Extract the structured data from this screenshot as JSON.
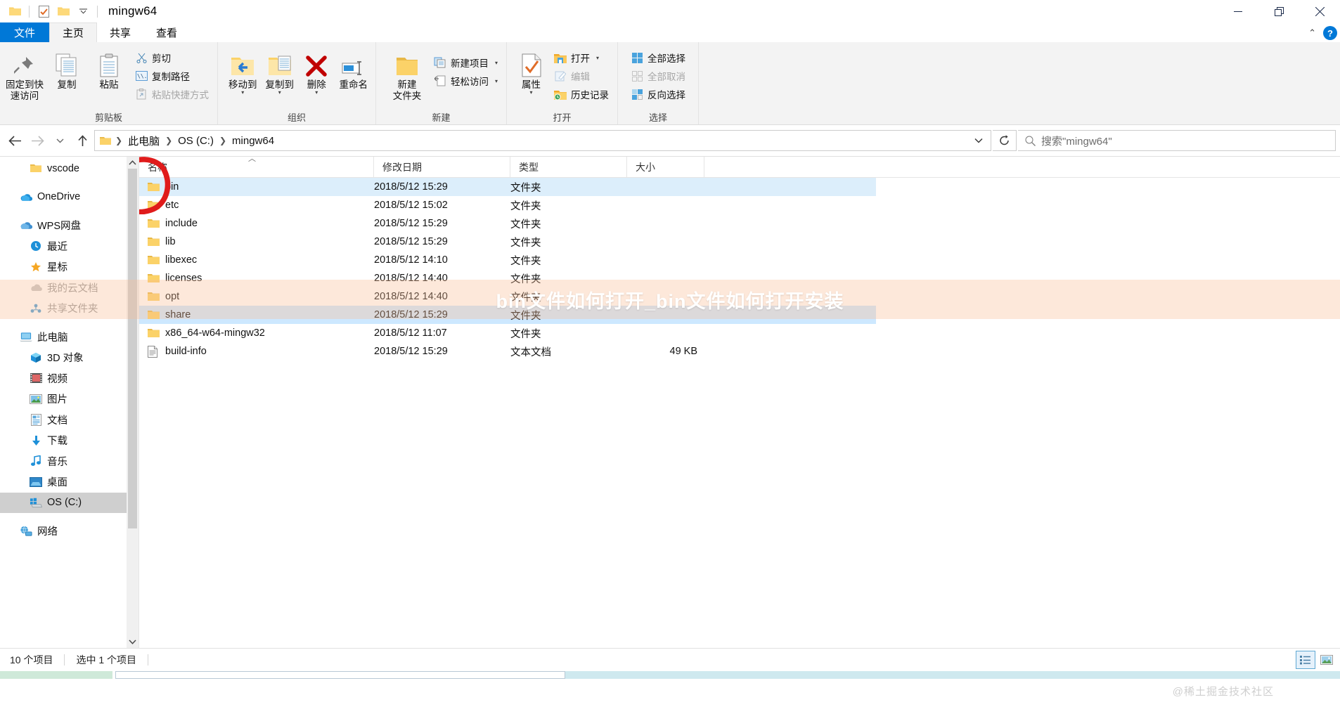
{
  "window": {
    "title": "mingw64",
    "quick_access": [
      "folder-icon",
      "properties-icon",
      "new-folder-icon",
      "dropdown-icon"
    ],
    "minimize": "—",
    "maximize": "❐",
    "close": "✕"
  },
  "tabs": [
    {
      "label": "文件",
      "id": "file"
    },
    {
      "label": "主页",
      "id": "home",
      "active": true
    },
    {
      "label": "共享",
      "id": "share"
    },
    {
      "label": "查看",
      "id": "view"
    }
  ],
  "tab_right": {
    "collapse": "⌃",
    "help": "?"
  },
  "ribbon": {
    "groups": [
      {
        "label": "剪贴板",
        "big": [
          {
            "label": "固定到快\n速访问",
            "icon": "pin-icon",
            "line1": "固定到快",
            "line2": "速访问"
          },
          {
            "label": "复制",
            "icon": "copy-icon",
            "line1": "复制",
            "line2": ""
          },
          {
            "label": "粘贴",
            "icon": "paste-icon",
            "line1": "粘贴",
            "line2": ""
          }
        ],
        "small": [
          {
            "label": "剪切",
            "icon": "scissors-icon",
            "disabled": false
          },
          {
            "label": "复制路径",
            "icon": "copy-path-icon",
            "disabled": false
          },
          {
            "label": "粘贴快捷方式",
            "icon": "paste-shortcut-icon",
            "disabled": true
          }
        ]
      },
      {
        "label": "组织",
        "big": [
          {
            "label": "移动到",
            "icon": "move-to-icon",
            "line1": "移动到",
            "line2": "",
            "dropdown": true
          },
          {
            "label": "复制到",
            "icon": "copy-to-icon",
            "line1": "复制到",
            "line2": "",
            "dropdown": true
          },
          {
            "label": "删除",
            "icon": "delete-icon",
            "line1": "删除",
            "line2": "",
            "dropdown": true
          },
          {
            "label": "重命名",
            "icon": "rename-icon",
            "line1": "重命名",
            "line2": ""
          }
        ],
        "small": []
      },
      {
        "label": "新建",
        "big": [
          {
            "label": "新建文件夹",
            "icon": "new-folder-icon",
            "line1": "新建",
            "line2": "文件夹"
          }
        ],
        "small": [
          {
            "label": "新建项目",
            "icon": "new-item-icon",
            "dropdown": true
          },
          {
            "label": "轻松访问",
            "icon": "easy-access-icon",
            "dropdown": true
          }
        ]
      },
      {
        "label": "打开",
        "big": [
          {
            "label": "属性",
            "icon": "properties-icon",
            "line1": "属性",
            "line2": "",
            "dropdown": true
          }
        ],
        "small": [
          {
            "label": "打开",
            "icon": "open-icon",
            "dropdown": true
          },
          {
            "label": "编辑",
            "icon": "edit-icon",
            "disabled": true
          },
          {
            "label": "历史记录",
            "icon": "history-icon"
          }
        ]
      },
      {
        "label": "选择",
        "big": [],
        "small": [
          {
            "label": "全部选择",
            "icon": "select-all-icon"
          },
          {
            "label": "全部取消",
            "icon": "select-none-icon",
            "disabled": true
          },
          {
            "label": "反向选择",
            "icon": "invert-selection-icon"
          }
        ]
      }
    ]
  },
  "address": {
    "back": "←",
    "forward": "→",
    "recent": "⌄",
    "up": "↑",
    "breadcrumbs": [
      "此电脑",
      "OS (C:)",
      "mingw64"
    ],
    "dropdown": "⌄",
    "refresh": "↻",
    "search_placeholder": "搜索\"mingw64\""
  },
  "sidebar": {
    "items": [
      {
        "label": "vscode",
        "icon": "folder-icon",
        "indent": 2
      },
      {
        "label": "OneDrive",
        "icon": "onedrive-icon",
        "indent": 1,
        "spacer_before": true
      },
      {
        "label": "WPS网盘",
        "icon": "wps-cloud-icon",
        "indent": 1,
        "spacer_before": true
      },
      {
        "label": "最近",
        "icon": "recent-clock-icon",
        "indent": 2
      },
      {
        "label": "星标",
        "icon": "star-icon",
        "indent": 2
      },
      {
        "label": "我的云文档",
        "icon": "cloud-doc-icon",
        "indent": 2,
        "dim": true
      },
      {
        "label": "共享文件夹",
        "icon": "shared-folder-icon",
        "indent": 2,
        "dim": true
      },
      {
        "label": "此电脑",
        "icon": "this-pc-icon",
        "indent": 1,
        "spacer_before": true
      },
      {
        "label": "3D 对象",
        "icon": "3d-objects-icon",
        "indent": 2
      },
      {
        "label": "视频",
        "icon": "videos-icon",
        "indent": 2
      },
      {
        "label": "图片",
        "icon": "pictures-icon",
        "indent": 2
      },
      {
        "label": "文档",
        "icon": "documents-icon",
        "indent": 2
      },
      {
        "label": "下载",
        "icon": "downloads-icon",
        "indent": 2
      },
      {
        "label": "音乐",
        "icon": "music-icon",
        "indent": 2
      },
      {
        "label": "桌面",
        "icon": "desktop-icon",
        "indent": 2
      },
      {
        "label": "OS (C:)",
        "icon": "drive-icon",
        "indent": 2,
        "selected": true
      },
      {
        "label": "网络",
        "icon": "network-icon",
        "indent": 1,
        "spacer_before": true
      }
    ],
    "scroll_up": "⌃",
    "scroll_down": "⌄"
  },
  "filelist": {
    "columns": [
      {
        "label": "名称",
        "key": "name"
      },
      {
        "label": "修改日期",
        "key": "date"
      },
      {
        "label": "类型",
        "key": "type"
      },
      {
        "label": "大小",
        "key": "size"
      }
    ],
    "sort_indicator": "︿",
    "rows": [
      {
        "name": "bin",
        "date": "2018/5/12 15:29",
        "type": "文件夹",
        "size": "",
        "icon": "folder-icon",
        "state": "focus-sel"
      },
      {
        "name": "etc",
        "date": "2018/5/12 15:02",
        "type": "文件夹",
        "size": "",
        "icon": "folder-icon",
        "state": ""
      },
      {
        "name": "include",
        "date": "2018/5/12 15:29",
        "type": "文件夹",
        "size": "",
        "icon": "folder-icon",
        "state": ""
      },
      {
        "name": "lib",
        "date": "2018/5/12 15:29",
        "type": "文件夹",
        "size": "",
        "icon": "folder-icon",
        "state": ""
      },
      {
        "name": "libexec",
        "date": "2018/5/12 14:10",
        "type": "文件夹",
        "size": "",
        "icon": "folder-icon",
        "state": ""
      },
      {
        "name": "licenses",
        "date": "2018/5/12 14:40",
        "type": "文件夹",
        "size": "",
        "icon": "folder-icon",
        "state": ""
      },
      {
        "name": "opt",
        "date": "2018/5/12 14:40",
        "type": "文件夹",
        "size": "",
        "icon": "folder-icon",
        "state": ""
      },
      {
        "name": "share",
        "date": "2018/5/12 15:29",
        "type": "文件夹",
        "size": "",
        "icon": "folder-icon",
        "state": "selected"
      },
      {
        "name": "x86_64-w64-mingw32",
        "date": "2018/5/12 11:07",
        "type": "文件夹",
        "size": "",
        "icon": "folder-icon",
        "state": ""
      },
      {
        "name": "build-info",
        "date": "2018/5/12 15:29",
        "type": "文本文档",
        "size": "49 KB",
        "icon": "text-file-icon",
        "state": ""
      }
    ]
  },
  "annotation": {
    "shape": "red-circle",
    "target": "bin"
  },
  "watermark": {
    "band_text": "bin文件如何打开_bin文件如何打开安装",
    "corner_text": "@稀土掘金技术社区"
  },
  "statusbar": {
    "item_count": "10 个项目",
    "selection": "选中 1 个项目",
    "views": [
      "details-view-icon",
      "large-icons-view-icon"
    ]
  },
  "colors": {
    "accent": "#0078d7",
    "selection": "#cde8ff",
    "folder": "#fbd268",
    "annotation": "#e01b1b",
    "watermark_band": "#fabe96"
  }
}
